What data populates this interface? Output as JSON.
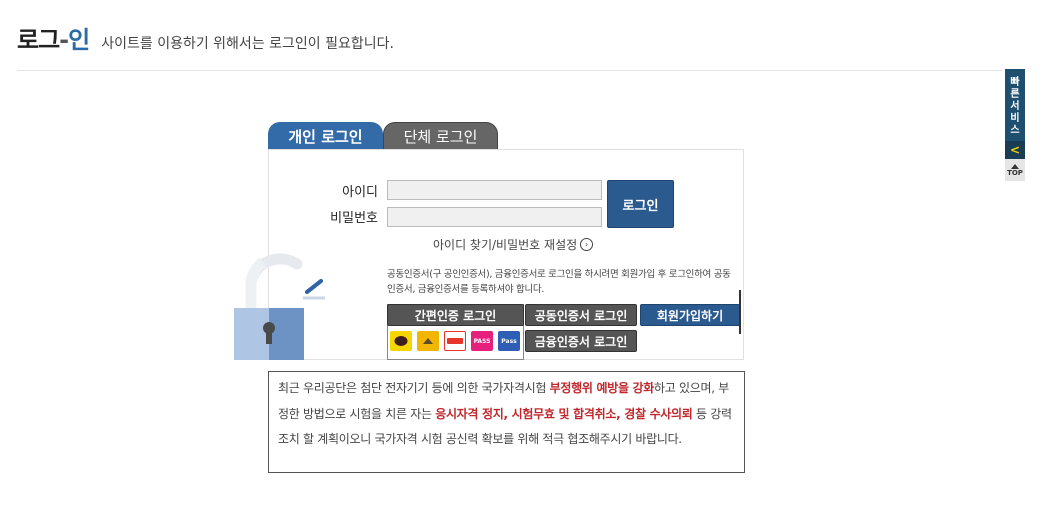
{
  "header": {
    "title_part1": "로그",
    "title_dash": "-",
    "title_part2": "인",
    "subtitle": "사이트를 이용하기 위해서는 로그인이 필요합니다."
  },
  "tabs": [
    {
      "label": "개인 로그인",
      "active": true
    },
    {
      "label": "단체 로그인",
      "active": false
    }
  ],
  "form": {
    "id_label": "아이디",
    "pw_label": "비밀번호",
    "id_value": "",
    "pw_value": "",
    "login_button": "로그인",
    "find_link": "아이디 찾기/비밀번호 재설정",
    "notice": "공동인증서(구 공인인증서), 금융인증서로 로그인을 하시려면 회원가입 후 로그인하여 공동인증서, 금융인증서를 등록하셔야 합니다."
  },
  "buttons": {
    "simple_auth": "간편인증 로그인",
    "joint_cert": "공동인증서 로그인",
    "financial_cert": "금융인증서 로그인",
    "join": "회원가입하기"
  },
  "cert_providers": [
    {
      "name": "kakao-icon",
      "label": "",
      "color": "#f7d600"
    },
    {
      "name": "kb-icon",
      "label": "",
      "color": "#f2b600"
    },
    {
      "name": "payco-icon",
      "label": "",
      "color": "#e8352b"
    },
    {
      "name": "pass-icon",
      "label": "PASS",
      "color": "#e6207d"
    },
    {
      "name": "pass-blue-icon",
      "label": "Pass",
      "color": "#2f5fb5"
    }
  ],
  "warning": {
    "p1": "최근 우리공단은 첨단 전자기기 등에 의한 국가자격시험 ",
    "h1": "부정행위 예방을 강화",
    "p2": "하고 있으며, 부정한 방법으로 시험을 치른 자는 ",
    "h2": "응시자격 정지, 시험무효 및 합격취소, 경찰 수사의뢰",
    "p3": " 등 강력조치 할 계획이오니 국가자격 시험 공신력 확보를 위해 적극 협조해주시기 바랍니다."
  },
  "quick_service": {
    "label_chars": [
      "빠",
      "른",
      "서",
      "비",
      "스"
    ],
    "arrow": "<",
    "top_label": "TOP"
  },
  "colors": {
    "primary": "#336ba8",
    "highlight": "#c0282d",
    "dark_button": "#555555"
  }
}
